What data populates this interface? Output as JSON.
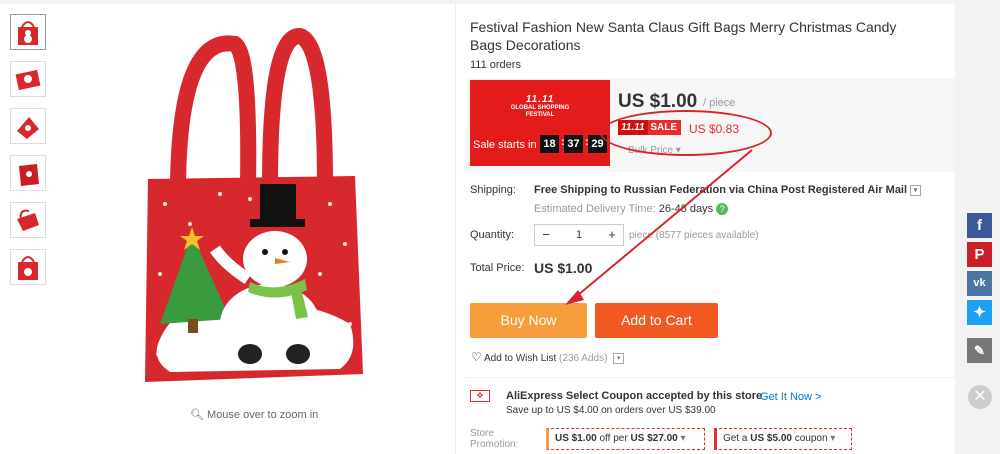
{
  "product": {
    "title": "Festival Fashion New Santa Claus Gift Bags Merry Christmas Candy Bags Decorations",
    "orders": "111 orders",
    "zoom_hint": "Mouse over to zoom in"
  },
  "promo": {
    "logo_big": "11.11",
    "logo_line1": "GLOBAL SHOPPING",
    "logo_line2": "FESTIVAL",
    "sale_starts_label": "Sale starts in",
    "timer": [
      "18",
      "37",
      "29"
    ]
  },
  "pricing": {
    "price": "US $1.00",
    "per_unit": "/ piece",
    "sale_badge_prefix": "11.11",
    "sale_badge_text": "SALE",
    "sale_price": "US $0.83",
    "bulk_price": "Bulk Price ▾"
  },
  "shipping": {
    "label": "Shipping:",
    "text_bold": "Free Shipping to Russian Federation via China Post Registered Air Mail",
    "delivery_label": "Estimated Delivery Time:",
    "delivery_value": "26-48 days"
  },
  "quantity": {
    "label": "Quantity:",
    "value": "1",
    "minus": "−",
    "plus": "+",
    "available": "piece (8577 pieces available)"
  },
  "total": {
    "label": "Total Price:",
    "value": "US $1.00"
  },
  "actions": {
    "buy_now": "Buy Now",
    "add_to_cart": "Add to Cart",
    "wishlist": "Add to Wish List",
    "wishlist_count": "(236 Adds)"
  },
  "coupons": {
    "headline": "AliExpress Select Coupon accepted by this store",
    "get_it": "Get It Now >",
    "detail": "Save up to US $4.00 on orders over US $39.00",
    "store_promotion_label": "Store Promotion:",
    "chip1_amount": "US $1.00",
    "chip1_mid": " off per ",
    "chip1_threshold": "US $27.00",
    "chip2_prefix": "Get a ",
    "chip2_amount": "US $5.00",
    "chip2_suffix": " coupon"
  },
  "social": [
    "facebook-icon",
    "pinterest-icon",
    "vk-icon",
    "twitter-icon",
    "edit-icon"
  ],
  "colors": {
    "accent_red": "#e62e2e",
    "buy_orange": "#f69d3c",
    "cart_orange": "#f05a22",
    "promo_red": "#e31b1b"
  }
}
